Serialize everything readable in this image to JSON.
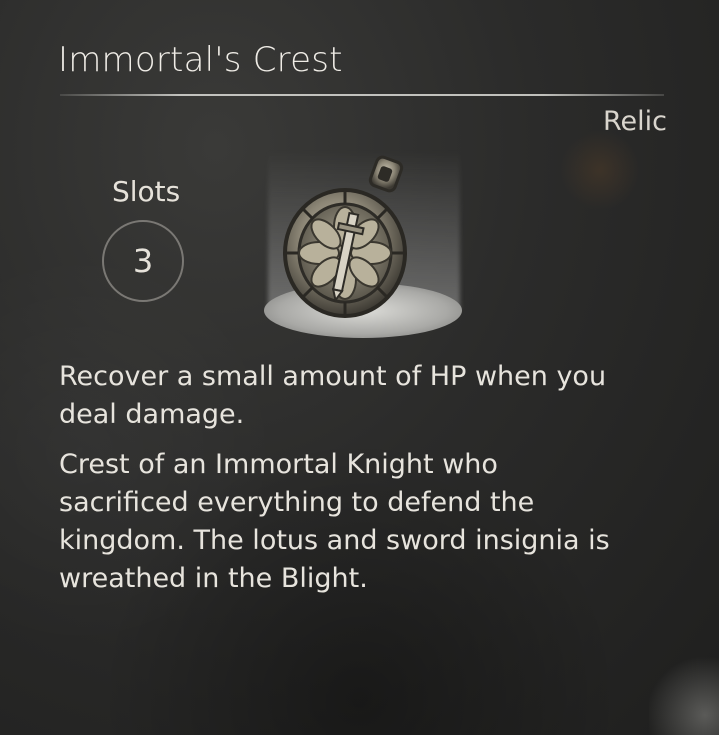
{
  "item": {
    "name": "Immortal's Crest",
    "category": "Relic",
    "slots_label": "Slots",
    "slots_value": "3",
    "effect": "Recover a small amount of HP when you deal damage.",
    "lore": "Crest of an Immortal Knight who sacrificed everything to defend the kingdom. The lotus and sword insignia is wreathed in the Blight.",
    "icon": "crest-pendant-icon"
  }
}
